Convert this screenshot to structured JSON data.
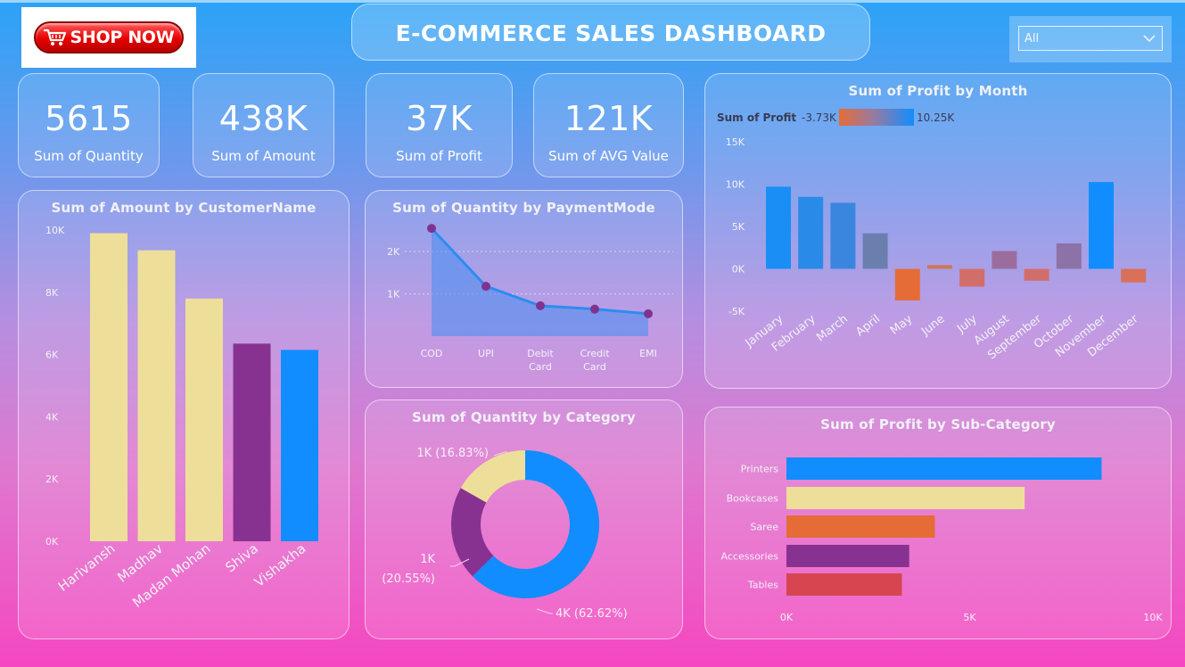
{
  "header": {
    "logo_text": "SHOP NOW",
    "title": "E-COMMERCE SALES DASHBOARD",
    "slicer_value": "All"
  },
  "kpis": [
    {
      "value": "5615",
      "label": "Sum of Quantity"
    },
    {
      "value": "438K",
      "label": "Sum of Amount"
    },
    {
      "value": "37K",
      "label": "Sum of Profit"
    },
    {
      "value": "121K",
      "label": "Sum of AVG Value"
    }
  ],
  "colors": {
    "blue": "#118dff",
    "cream": "#eddf99",
    "purple": "#873290",
    "orange": "#e66c37",
    "red": "#d64550",
    "steel": "#6b7fae",
    "mauve": "#9b6d9c"
  },
  "chart_data": [
    {
      "id": "amount-by-customer",
      "type": "bar",
      "title": "Sum of Amount by CustomerName",
      "categories": [
        "Harivansh",
        "Madhav",
        "Madan Mohan",
        "Shiva",
        "Vishakha"
      ],
      "values": [
        9900,
        9350,
        7800,
        6350,
        6150
      ],
      "bar_colors": [
        "#eddf99",
        "#eddf99",
        "#eddf99",
        "#873290",
        "#118dff"
      ],
      "yticks": [
        "0K",
        "2K",
        "4K",
        "6K",
        "8K",
        "10K"
      ],
      "ylim": [
        0,
        10000
      ]
    },
    {
      "id": "quantity-by-paymentmode",
      "type": "area",
      "title": "Sum of Quantity by PaymentMode",
      "categories": [
        "COD",
        "UPI",
        "Debit Card",
        "Credit Card",
        "EMI"
      ],
      "values": [
        2550,
        1180,
        720,
        640,
        530
      ],
      "yticks": [
        "1K",
        "2K"
      ],
      "ylim": [
        0,
        2700
      ]
    },
    {
      "id": "quantity-by-category",
      "type": "pie",
      "title": "Sum of Quantity by Category",
      "slices": [
        {
          "label": "4K (62.62%)",
          "value": 62.62,
          "color": "#118dff"
        },
        {
          "label": "1K (20.55%)",
          "value": 20.55,
          "color": "#873290"
        },
        {
          "label": "1K (16.83%)",
          "value": 16.83,
          "color": "#eddf99"
        }
      ]
    },
    {
      "id": "profit-by-month",
      "type": "bar",
      "title": "Sum of Profit by Month",
      "legend": {
        "label": "Sum of Profit",
        "min": "-3.73K",
        "max": "10.25K"
      },
      "categories": [
        "January",
        "February",
        "March",
        "April",
        "May",
        "June",
        "July",
        "August",
        "September",
        "October",
        "November",
        "December"
      ],
      "values": [
        9700,
        8500,
        7800,
        4200,
        -3730,
        450,
        -2100,
        2100,
        -1400,
        3000,
        10250,
        -1600
      ],
      "bar_colors": [
        "#1a8ef5",
        "#2a8ae8",
        "#3a86de",
        "#6b7fae",
        "#e66c37",
        "#c9785f",
        "#d26e6a",
        "#9b6d9c",
        "#d26e6a",
        "#8c72a6",
        "#118dff",
        "#d8705a"
      ],
      "yticks": [
        "-5K",
        "0K",
        "5K",
        "10K",
        "15K"
      ],
      "ylim": [
        -5000,
        15000
      ]
    },
    {
      "id": "profit-by-subcategory",
      "type": "bar",
      "orientation": "horizontal",
      "title": "Sum of Profit by Sub-Category",
      "categories": [
        "Printers",
        "Bookcases",
        "Saree",
        "Accessories",
        "Tables"
      ],
      "values": [
        8600,
        6500,
        4050,
        3350,
        3150
      ],
      "bar_colors": [
        "#118dff",
        "#eddf99",
        "#e66c37",
        "#873290",
        "#d64550"
      ],
      "xticks": [
        "0K",
        "5K",
        "10K"
      ],
      "xlim": [
        0,
        10000
      ]
    }
  ]
}
